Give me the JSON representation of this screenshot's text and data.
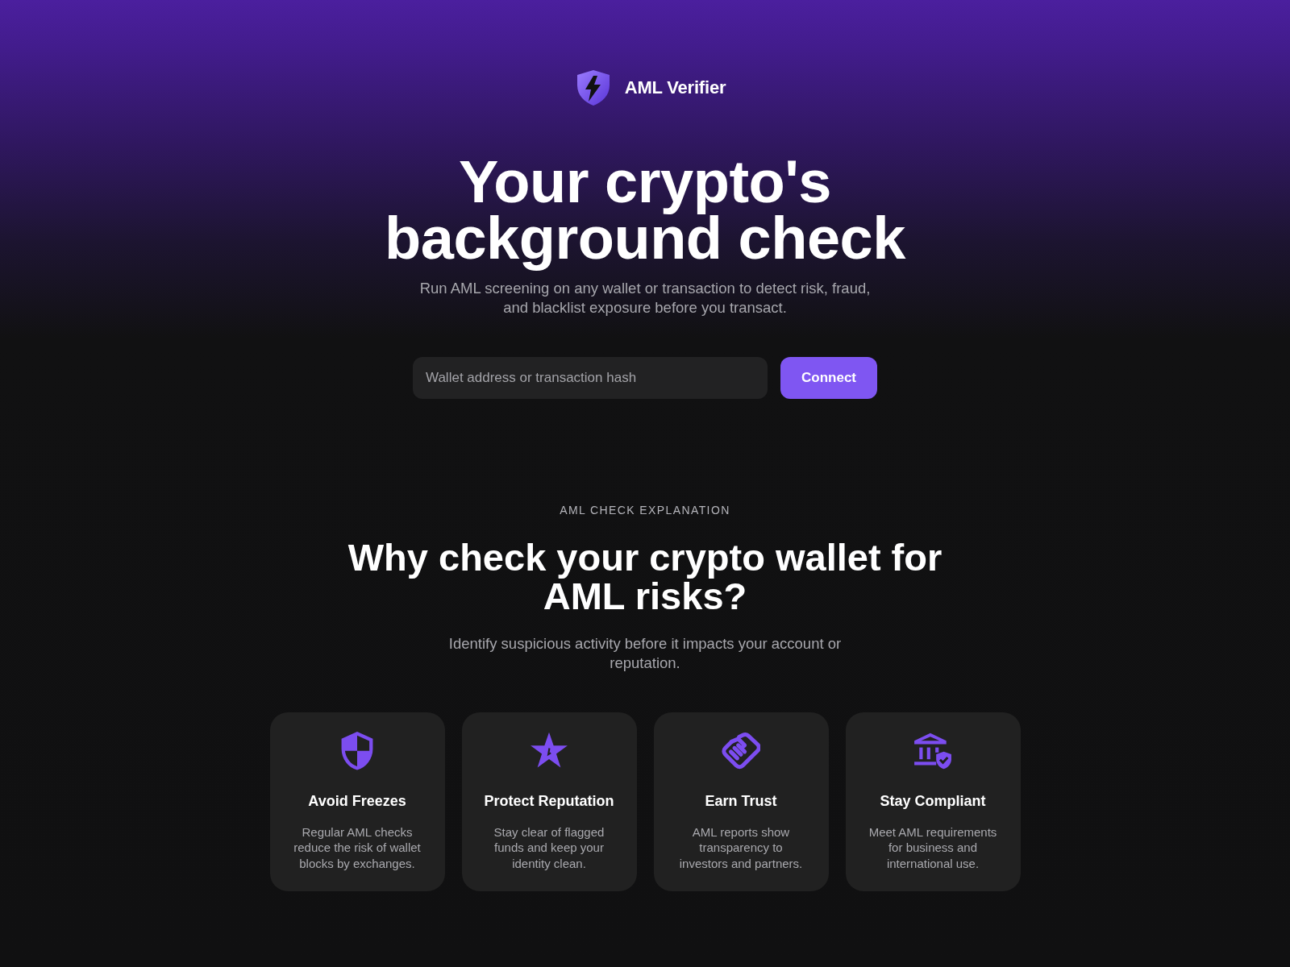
{
  "header": {
    "brand": "AML Verifier"
  },
  "hero": {
    "title": "Your crypto's background check",
    "subtitle": "Run AML screening on any wallet or transaction to detect risk, fraud, and blacklist exposure before you transact.",
    "search": {
      "placeholder": "Wallet address or transaction hash"
    },
    "button": "Connect"
  },
  "explanation": {
    "eyebrow": "AML CHECK EXPLANATION",
    "title": "Why check your crypto wallet for AML risks?",
    "subtitle": "Identify suspicious activity before it impacts your account or reputation.",
    "features": [
      {
        "kind": "shield",
        "title": "Avoid Freezes",
        "text": "Regular AML checks reduce the risk of wallet blocks by exchanges."
      },
      {
        "kind": "star",
        "title": "Protect Reputation",
        "text": "Stay clear of flagged funds and keep your identity clean."
      },
      {
        "kind": "handshake",
        "title": "Earn Trust",
        "text": "AML reports show transparency to investors and partners."
      },
      {
        "kind": "bank",
        "title": "Stay Compliant",
        "text": "Meet AML requirements for business and international use."
      }
    ]
  }
}
